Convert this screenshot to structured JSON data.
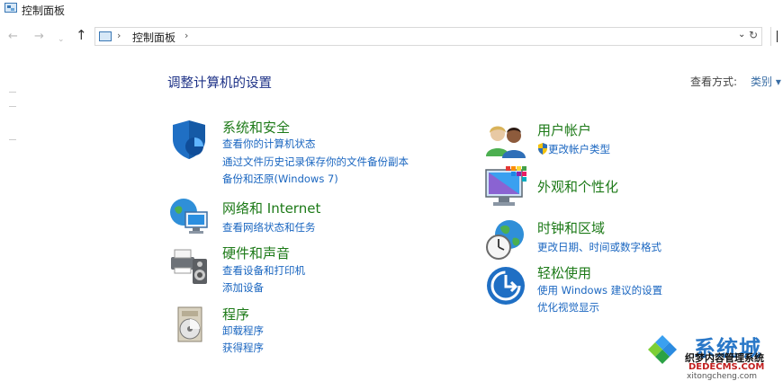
{
  "window": {
    "title": "控制面板"
  },
  "nav": {
    "back_icon": "←",
    "forward_icon": "→",
    "recent_icon": "⌄",
    "up_icon": "↑",
    "address_path": "控制面板",
    "path_sep": "›",
    "dropdown_icon": "⌄",
    "refresh_icon": "↻"
  },
  "main": {
    "title": "调整计算机的设置",
    "view_label": "查看方式:",
    "view_value": "类别"
  },
  "categories": {
    "system": {
      "title": "系统和安全",
      "links": [
        "查看你的计算机状态",
        "通过文件历史记录保存你的文件备份副本",
        "备份和还原(Windows 7)"
      ]
    },
    "network": {
      "title": "网络和 Internet",
      "links": [
        "查看网络状态和任务"
      ]
    },
    "hardware": {
      "title": "硬件和声音",
      "links": [
        "查看设备和打印机",
        "添加设备"
      ]
    },
    "programs": {
      "title": "程序",
      "links": [
        "卸载程序",
        "获得程序"
      ]
    },
    "user": {
      "title": "用户帐户",
      "links": [
        "更改帐户类型"
      ]
    },
    "appearance": {
      "title": "外观和个性化",
      "links": []
    },
    "clock": {
      "title": "时钟和区域",
      "links": [
        "更改日期、时间或数字格式"
      ]
    },
    "ease": {
      "title": "轻松使用",
      "links": [
        "使用 Windows 建议的设置",
        "优化视觉显示"
      ]
    }
  },
  "watermark": {
    "big": "系统城",
    "line1": "织梦内容管理系统",
    "line2": "DEDECMS.COM",
    "line3": "xitongcheng.com"
  },
  "colors": {
    "category_title": "#1d7a18",
    "link": "#1a66c0",
    "heading": "#1e3287"
  }
}
